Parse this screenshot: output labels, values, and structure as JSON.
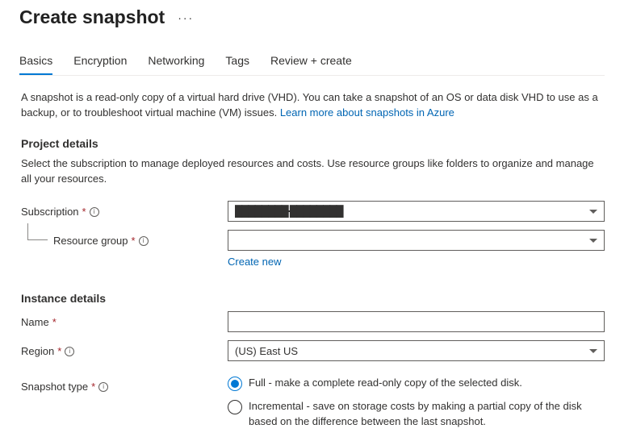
{
  "header": {
    "title": "Create snapshot",
    "more": "···"
  },
  "tabs": {
    "basics": "Basics",
    "encryption": "Encryption",
    "networking": "Networking",
    "tags": "Tags",
    "review": "Review + create"
  },
  "intro": {
    "text": "A snapshot is a read-only copy of a virtual hard drive (VHD). You can take a snapshot of an OS or data disk VHD to use as a backup, or to troubleshoot virtual machine (VM) issues.  ",
    "link": "Learn more about snapshots in Azure"
  },
  "project": {
    "heading": "Project details",
    "desc": "Select the subscription to manage deployed resources and costs. Use resource groups like folders to organize and manage all your resources.",
    "subscription_label": "Subscription",
    "subscription_value": "████████ ████████",
    "resource_group_label": "Resource group",
    "resource_group_value": "",
    "create_new": "Create new"
  },
  "instance": {
    "heading": "Instance details",
    "name_label": "Name",
    "name_value": "",
    "region_label": "Region",
    "region_value": "(US) East US",
    "snapshot_type_label": "Snapshot type",
    "opt_full": "Full - make a complete read-only copy of the selected disk.",
    "opt_incremental": "Incremental - save on storage costs by making a partial copy of the disk based on the difference between the last snapshot."
  }
}
